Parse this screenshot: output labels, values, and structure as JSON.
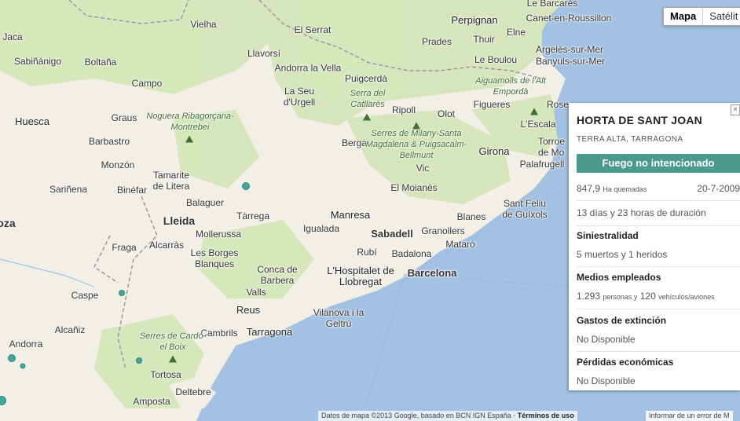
{
  "map_type": {
    "map_label": "Mapa",
    "satellite_label": "Satélit"
  },
  "places": {
    "jaca": "Jaca",
    "sabinanigo": "Sabiñánigo",
    "boltana": "Boltaña",
    "vielha": "Vielha",
    "el_serrat": "El Serrat",
    "perpignan": "Perpignan",
    "canet": "Canet-en-Roussillon",
    "prades": "Prades",
    "thuir": "Thuir",
    "elne": "Elne",
    "argeles": "Argelès-sur-Mer",
    "banyuls": "Banyuls-sur-Mer",
    "le_boulou": "Le Boulou",
    "llavorsi": "Llavorsí",
    "andorra_la_vella": "Andorra la Vella",
    "puigcerda": "Puigcerdà",
    "campo": "Campo",
    "la_seu": "La Seu d'Urgell",
    "huesca": "Huesca",
    "graus": "Graus",
    "ripoll": "Ripoll",
    "olot": "Olot",
    "figueres": "Figueres",
    "rosa": "Rose",
    "barbastro": "Barbastro",
    "berga": "Berga",
    "escala": "L'Escala",
    "torroella": "Torroe de Mo",
    "monzon": "Monzón",
    "girona": "Girona",
    "palafrugell": "Palafrugell",
    "tamarite": "Tamarite de Litera",
    "vic": "Vic",
    "sarinena": "Sariñena",
    "binefar": "Binéfar",
    "el_moianes": "El Moianès",
    "balaguer": "Balaguer",
    "sant_feliu": "Sant Feliu de Guíxols",
    "lleida": "Lleida",
    "tarrega": "Tàrrega",
    "manresa": "Manresa",
    "blanes": "Blanes",
    "oza": "oza",
    "mollerussa": "Mollerussa",
    "igualada": "Igualada",
    "sabadell": "Sabadell",
    "granollers": "Granollers",
    "fraga": "Fraga",
    "alcarras": "Alcarràs",
    "mataro": "Mataró",
    "rubi": "Rubí",
    "badalona": "Badalona",
    "borges": "Les Borges Blanques",
    "conca": "Conca de Barbera",
    "hospitalet": "L'Hospitalet de Llobregat",
    "barcelona": "Barcelona",
    "caspe": "Caspe",
    "valls": "Valls",
    "reus": "Reus",
    "vilanova": "Vilanova i la Geltrú",
    "alcaniz": "Alcañiz",
    "cambrils": "Cambrils",
    "tarragona": "Tarragona",
    "andorra": "Andorra",
    "tortosa": "Tortosa",
    "deltebre": "Deltebre",
    "amposta": "Amposta",
    "bages": "Le Barcarès"
  },
  "parks": {
    "noguera": "Noguera Ribagorçana-Montrebei",
    "cadi": "Serra del Catllarès",
    "aiguamolls": "Aiguamolls de l'Alt Empordà",
    "milany": "Serres de Milany-Santa Magdalena & Puigsacalm-Bellmunt",
    "cardo": "Serres de Cardó-el Boix"
  },
  "info_panel": {
    "title": "HORTA DE SANT JOAN",
    "subtitle": "TERRA ALTA, TARRAGONA",
    "cause": "Fuego no intencionado",
    "hectares_value": "847,9",
    "hectares_unit": "Ha quemadas",
    "date": "20-7-2009",
    "duration": "13 días y 23 horas de duración",
    "casualties_heading": "Siniestralidad",
    "casualties": "5 muertos y 1 heridos",
    "resources_heading": "Medios empleados",
    "people_value": "1.293",
    "people_unit": "personas y",
    "vehicles_value": "120",
    "vehicles_unit": "vehículos/aviones",
    "cost_heading": "Gastos de extinción",
    "cost": "No Disponible",
    "losses_heading": "Pérdidas económicas",
    "losses": "No Disponible",
    "accent_color": "#4b9a8b"
  },
  "footer": {
    "attribution": "Datos de mapa ©2013 Google, basado en BCN IGN España -",
    "terms": "Términos de uso",
    "report": "Informar de un error de M"
  },
  "colors": {
    "sea": "#a3c1e2",
    "land": "#f2efe6",
    "forest": "#cfe3b3",
    "marker": "#4aa39a"
  }
}
